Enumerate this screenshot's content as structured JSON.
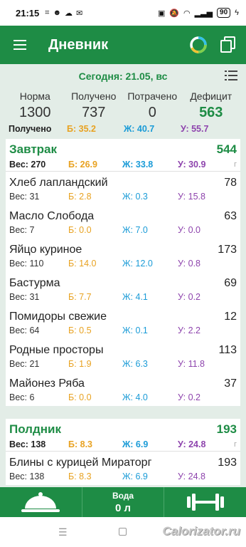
{
  "status": {
    "time": "21:15",
    "battery": "90"
  },
  "appbar": {
    "title": "Дневник"
  },
  "date_label": "Сегодня: 21.05, вс",
  "summary": {
    "headers": [
      "Норма",
      "Получено",
      "Потрачено",
      "Дефицит"
    ],
    "values": [
      "1300",
      "737",
      "0",
      "563"
    ],
    "macros": {
      "label": "Получено",
      "b": "Б: 35.2",
      "f": "Ж: 40.7",
      "c": "У: 55.7"
    }
  },
  "meals": [
    {
      "name": "Завтрак",
      "kcal": "544",
      "weight": "Вес: 270",
      "b": "Б: 26.9",
      "f": "Ж: 33.8",
      "c": "У: 30.9",
      "unit": "г",
      "items": [
        {
          "name": "Хлеб лапландский",
          "kcal": "78",
          "weight": "Вес: 31",
          "b": "Б: 2.8",
          "f": "Ж: 0.3",
          "c": "У: 15.8"
        },
        {
          "name": "Масло Слобода",
          "kcal": "63",
          "weight": "Вес: 7",
          "b": "Б: 0.0",
          "f": "Ж: 7.0",
          "c": "У: 0.0"
        },
        {
          "name": "Яйцо куриное",
          "kcal": "173",
          "weight": "Вес: 110",
          "b": "Б: 14.0",
          "f": "Ж: 12.0",
          "c": "У: 0.8"
        },
        {
          "name": "Бастурма",
          "kcal": "69",
          "weight": "Вес: 31",
          "b": "Б: 7.7",
          "f": "Ж: 4.1",
          "c": "У: 0.2"
        },
        {
          "name": "Помидоры свежие",
          "kcal": "12",
          "weight": "Вес: 64",
          "b": "Б: 0.5",
          "f": "Ж: 0.1",
          "c": "У: 2.2"
        },
        {
          "name": "Родные просторы",
          "kcal": "113",
          "weight": "Вес: 21",
          "b": "Б: 1.9",
          "f": "Ж: 6.3",
          "c": "У: 11.8"
        },
        {
          "name": "Майонез Ряба",
          "kcal": "37",
          "weight": "Вес: 6",
          "b": "Б: 0.0",
          "f": "Ж: 4.0",
          "c": "У: 0.2"
        }
      ]
    },
    {
      "name": "Полдник",
      "kcal": "193",
      "weight": "Вес: 138",
      "b": "Б: 8.3",
      "f": "Ж: 6.9",
      "c": "У: 24.8",
      "unit": "г",
      "items": [
        {
          "name": "Блины с курицей Мираторг",
          "kcal": "193",
          "weight": "Вес: 138",
          "b": "Б: 8.3",
          "f": "Ж: 6.9",
          "c": "У: 24.8"
        }
      ]
    }
  ],
  "bottom": {
    "water_label": "Вода",
    "water_value": "0 л"
  },
  "watermark": "Calorizator.ru",
  "colors": {
    "primary_green": "#1e8c45",
    "proteins": "#e8a221",
    "fats": "#1a9bd7",
    "carbs": "#8e44ad",
    "background": "#e3ede7"
  }
}
